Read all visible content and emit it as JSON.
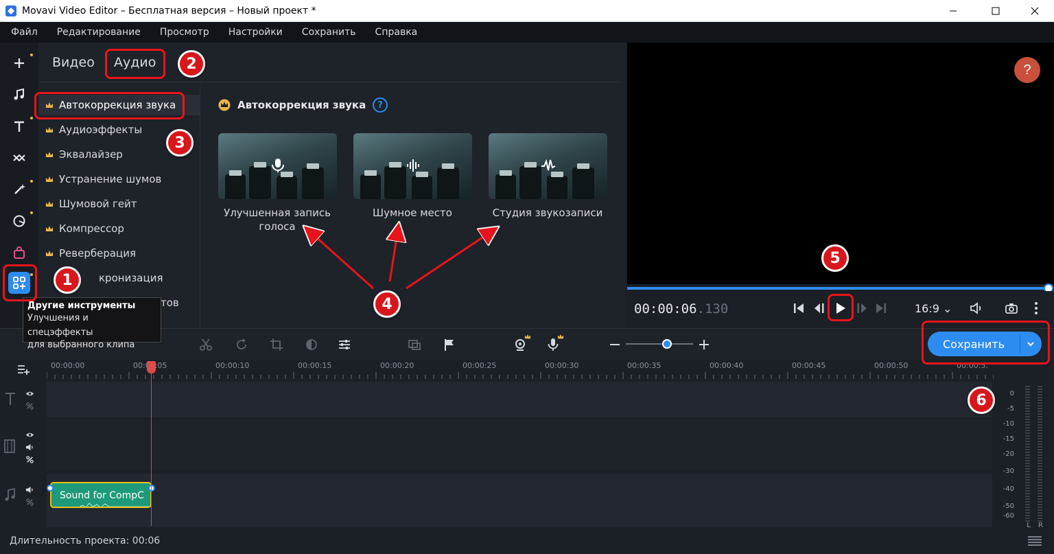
{
  "window": {
    "title": "Movavi Video Editor – Бесплатная версия – Новый проект *"
  },
  "menu": [
    "Файл",
    "Редактирование",
    "Просмотр",
    "Настройки",
    "Сохранить",
    "Справка"
  ],
  "tabs": {
    "video": "Видео",
    "audio": "Аудио"
  },
  "sidelist": [
    "Автокоррекция звука",
    "Аудиоэффекты",
    "Эквалайзер",
    "Устранение шумов",
    "Шумовой гейт",
    "Компрессор",
    "Реверберация",
    "кронизация",
    "тов"
  ],
  "content": {
    "title": "Автокоррекция звука",
    "help": "?",
    "cards": [
      {
        "label": "Улучшенная запись голоса",
        "icon": "microphone-icon"
      },
      {
        "label": "Шумное место",
        "icon": "waveform-icon"
      },
      {
        "label": "Студия звукозаписи",
        "icon": "studio-wave-icon"
      }
    ]
  },
  "preview": {
    "help": "?",
    "timecode_main": "00:00:06",
    "timecode_ms": ".130",
    "ratio": "16:9"
  },
  "toolbar": {
    "save_label": "Сохранить"
  },
  "ruler": [
    "00:00:00",
    "00:00:05",
    "00:00:10",
    "00:00:15",
    "00:00:20",
    "00:00:25",
    "00:00:30",
    "00:00:35",
    "00:00:40",
    "00:00:45",
    "00:00:50",
    "00:00:5."
  ],
  "clip": {
    "label": "Sound for CompC"
  },
  "meter": {
    "labels": [
      "0",
      "-5",
      "-10",
      "-15",
      "-20",
      "-30",
      "-40",
      "-50",
      "-60"
    ],
    "channels": [
      "L",
      "R"
    ]
  },
  "status": {
    "text": "Длительность проекта: 00:06"
  },
  "tooltip": {
    "title": "Другие инструменты",
    "line1": "Улучшения и спецэффекты",
    "line2": "для выбранного клипа"
  },
  "badges": [
    "1",
    "2",
    "3",
    "4",
    "5",
    "6"
  ],
  "colors": {
    "accent": "#2d8cf0",
    "annotation": "#e8141b",
    "clip": "#1e9a7a",
    "crown": "#e8b64c"
  }
}
